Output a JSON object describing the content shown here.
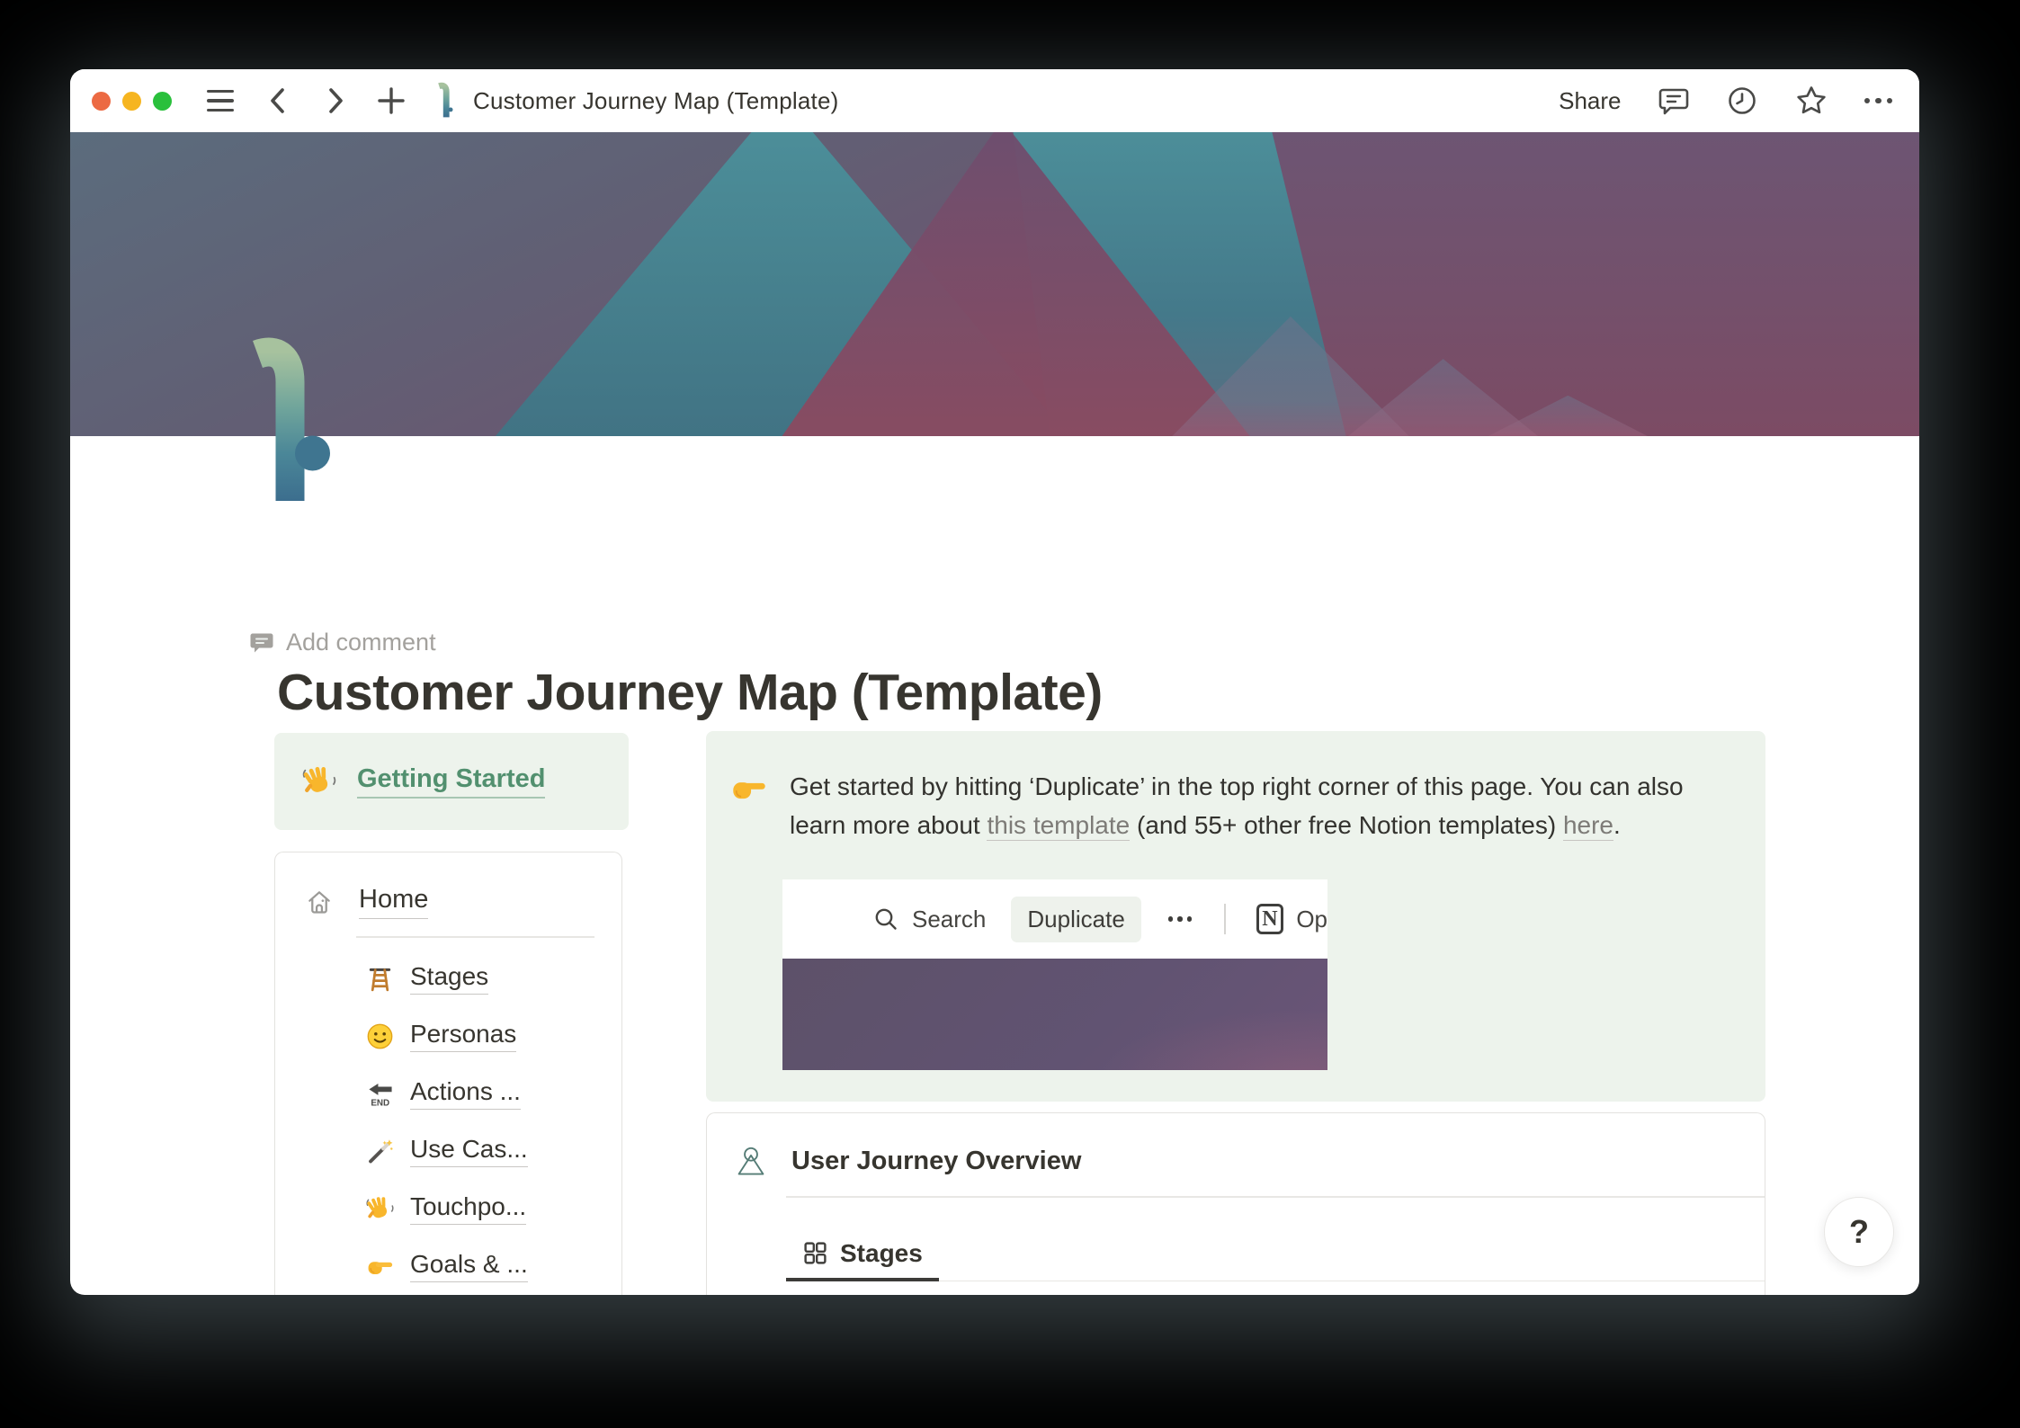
{
  "titlebar": {
    "title": "Customer Journey Map (Template)",
    "share_label": "Share"
  },
  "page": {
    "add_comment_label": "Add comment",
    "title": "Customer Journey Map (Template)"
  },
  "getting_started": {
    "label": "Getting Started"
  },
  "nav_card": {
    "home_label": "Home",
    "items": [
      {
        "label": "Stages",
        "icon": "ladder-emoji"
      },
      {
        "label": "Personas",
        "icon": "smiley-emoji"
      },
      {
        "label": "Actions ...",
        "icon": "end-arrow-emoji"
      },
      {
        "label": "Use Cas...",
        "icon": "magic-wand-emoji"
      },
      {
        "label": "Touchpo...",
        "icon": "wave-emoji"
      },
      {
        "label": "Goals & ...",
        "icon": "point-right-emoji"
      }
    ]
  },
  "callout": {
    "seg1": "Get started by hitting ‘Duplicate’ in the top right corner of this page. You can also learn more about ",
    "link1": "this template",
    "seg2": " (and 55+ other free Notion templates) ",
    "link2": "here",
    "seg3": ".",
    "screenshot": {
      "search_label": "Search",
      "duplicate_label": "Duplicate",
      "notion_letter": "N",
      "open_label": "Op"
    }
  },
  "overview_card": {
    "title": "User Journey Overview",
    "tab_label": "Stages"
  },
  "help": {
    "label": "?"
  },
  "colors": {
    "green_bg": "#edf3ec",
    "green_text": "#52906f",
    "banner_teal": "#47828f",
    "banner_maroon": "#7c4a63",
    "shot_cover_purple": "#5e5169",
    "text_dark": "#37352f"
  }
}
